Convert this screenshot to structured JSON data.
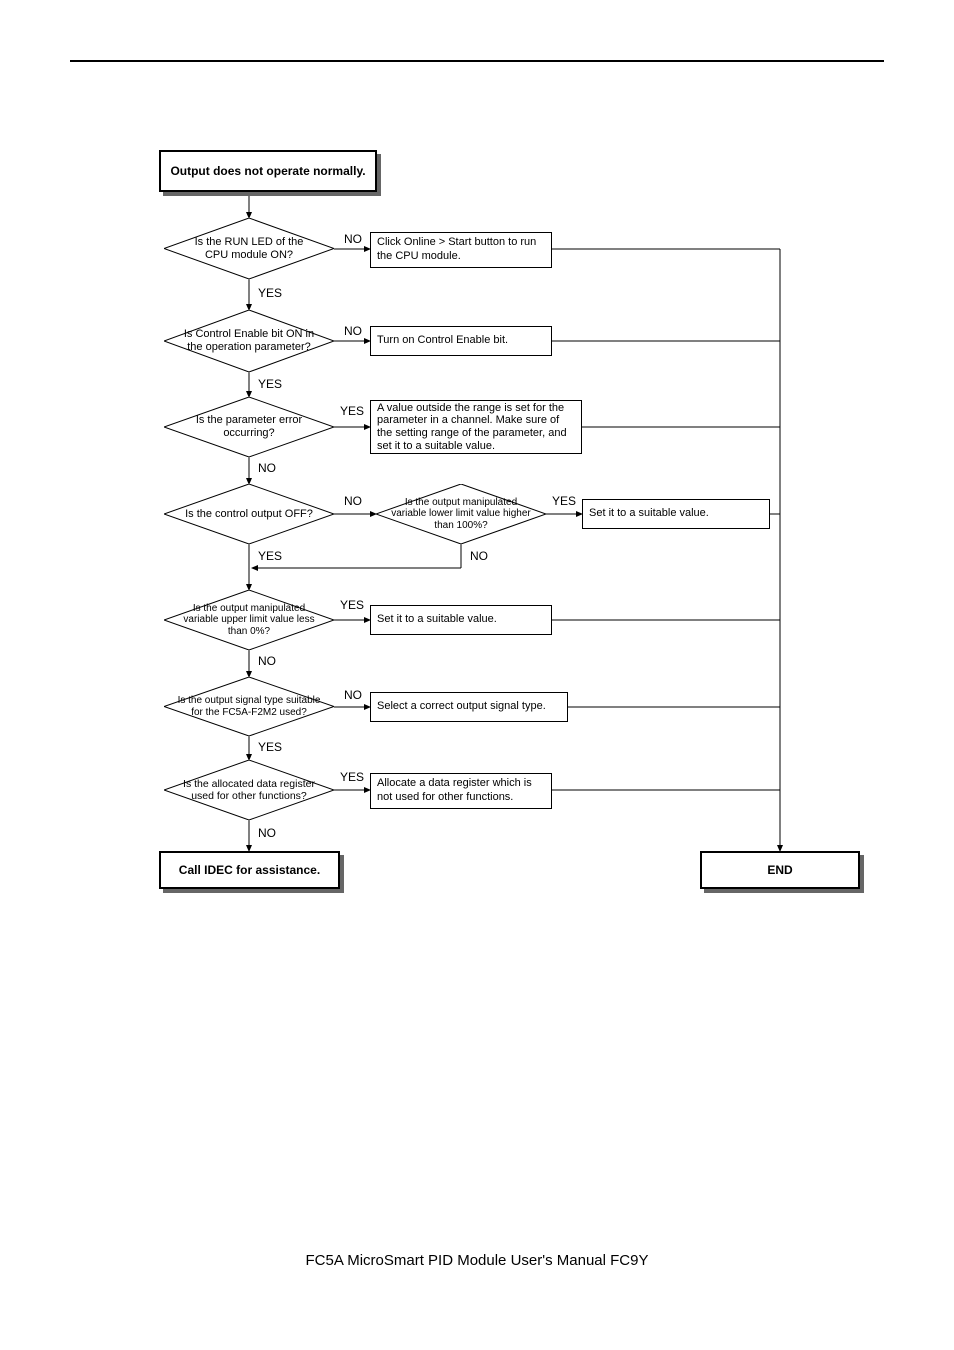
{
  "header": {
    "title": ""
  },
  "footer": {
    "text": "FC5A MicroSmart PID Module User's Manual FC9Y"
  },
  "labels": {
    "yes": "YES",
    "no": "NO"
  },
  "flow": {
    "start": "Output does not operate normally.",
    "d1": "Is the RUN LED of the CPU module ON?",
    "a1": "Click Online > Start button to run the CPU module.",
    "d2": "Is Control Enable bit ON in the operation parameter?",
    "a2": "Turn on  Control Enable bit.",
    "d3": "Is the parameter error occurring?",
    "a3": "A value outside the range is set for the parameter in a channel. Make sure of the setting range of the parameter, and set it to a suitable value.",
    "d4": "Is the control output OFF?",
    "d4b": "Is the output manipulated variable lower limit value higher than 100%?",
    "a4b": "Set it to a suitable value.",
    "d5": "Is the output manipulated variable upper limit value less than 0%?",
    "a5": "Set it to a suitable value.",
    "d6": "Is the output signal type suitable for the FC5A-F2M2 used?",
    "a6": "Select a correct output signal type.",
    "d7": "Is the allocated data register used for other functions?",
    "a7": "Allocate a data register which is not used for other functions.",
    "call": "Call IDEC for assistance.",
    "end": "END"
  }
}
